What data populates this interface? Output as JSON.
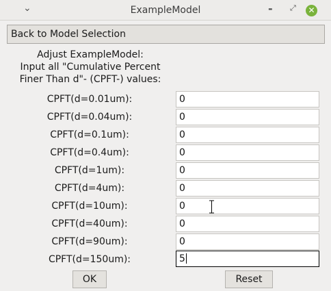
{
  "window": {
    "title": "ExampleModel",
    "menu_glyph": "⌄",
    "minimize_glyph": "-",
    "restore_glyph": "⤢",
    "close_glyph": "✕",
    "close_color": "#7ab33c"
  },
  "back_button_label": "Back to Model Selection",
  "instructions": [
    "Adjust ExampleModel:",
    "Input all \"Cumulative Percent",
    "Finer Than d\"- (CPFT-) values:"
  ],
  "rows": [
    {
      "label": "CPFT(d=0.01um):",
      "value": "0"
    },
    {
      "label": "CPFT(d=0.04um):",
      "value": "0"
    },
    {
      "label": "CPFT(d=0.1um):",
      "value": "0"
    },
    {
      "label": "CPFT(d=0.4um):",
      "value": "0"
    },
    {
      "label": "CPFT(d=1um):",
      "value": "0"
    },
    {
      "label": "CPFT(d=4um):",
      "value": "0"
    },
    {
      "label": "CPFT(d=10um):",
      "value": "0"
    },
    {
      "label": "CPFT(d=40um):",
      "value": "0"
    },
    {
      "label": "CPFT(d=90um):",
      "value": "0"
    },
    {
      "label": "CPFT(d=150um):",
      "value": "5"
    }
  ],
  "ok_label": "OK",
  "reset_label": "Reset",
  "active_row_index": 9,
  "cursor_icon": "text-cursor-icon"
}
